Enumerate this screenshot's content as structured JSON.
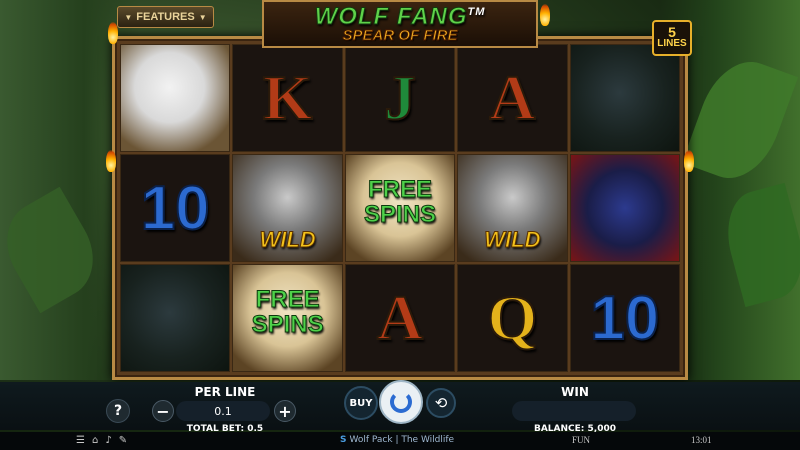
{
  "title": {
    "main": "WOLF FANG",
    "tm": "TM",
    "subtitle": "SPEAR OF FIRE"
  },
  "features_button": {
    "label": "FEATURES",
    "arrow_left": "▼",
    "arrow_right": "▼"
  },
  "lines_badge": {
    "number": "5",
    "label": "LINES"
  },
  "reels": [
    [
      "eagle",
      "10",
      "snake"
    ],
    [
      "K",
      "wolf-wild",
      "free-spins"
    ],
    [
      "J",
      "free-spins",
      "A"
    ],
    [
      "A",
      "wolf-wild",
      "Q"
    ],
    [
      "snake",
      "gorilla",
      "10"
    ]
  ],
  "symbol_text": {
    "wild": "WILD",
    "free": "FREE",
    "spins": "SPINS",
    "ten": "10",
    "K": "K",
    "J": "J",
    "A": "A",
    "Q": "Q"
  },
  "controls": {
    "help_label": "?",
    "per_line_label": "PER LINE",
    "per_line_value": "0.1",
    "minus_label": "−",
    "plus_label": "+",
    "total_bet": "TOTAL BET: 0.5",
    "buy_label": "BUY",
    "autoplay_icon": "⟲",
    "win_label": "WIN",
    "win_value": "",
    "balance": "BALANCE: 5,000"
  },
  "status": {
    "logo": "S",
    "game_title": "Wolf Pack | The Wildlife",
    "mode": "FUN",
    "time": "13:01",
    "icons": [
      "menu-icon",
      "home-icon",
      "sound-icon",
      "settings-icon"
    ]
  },
  "colors": {
    "title_green": "#5fd24a",
    "subtitle_orange": "#f2b022",
    "frame_gold": "#b88a44",
    "spin_blue": "#2b6bd1"
  }
}
